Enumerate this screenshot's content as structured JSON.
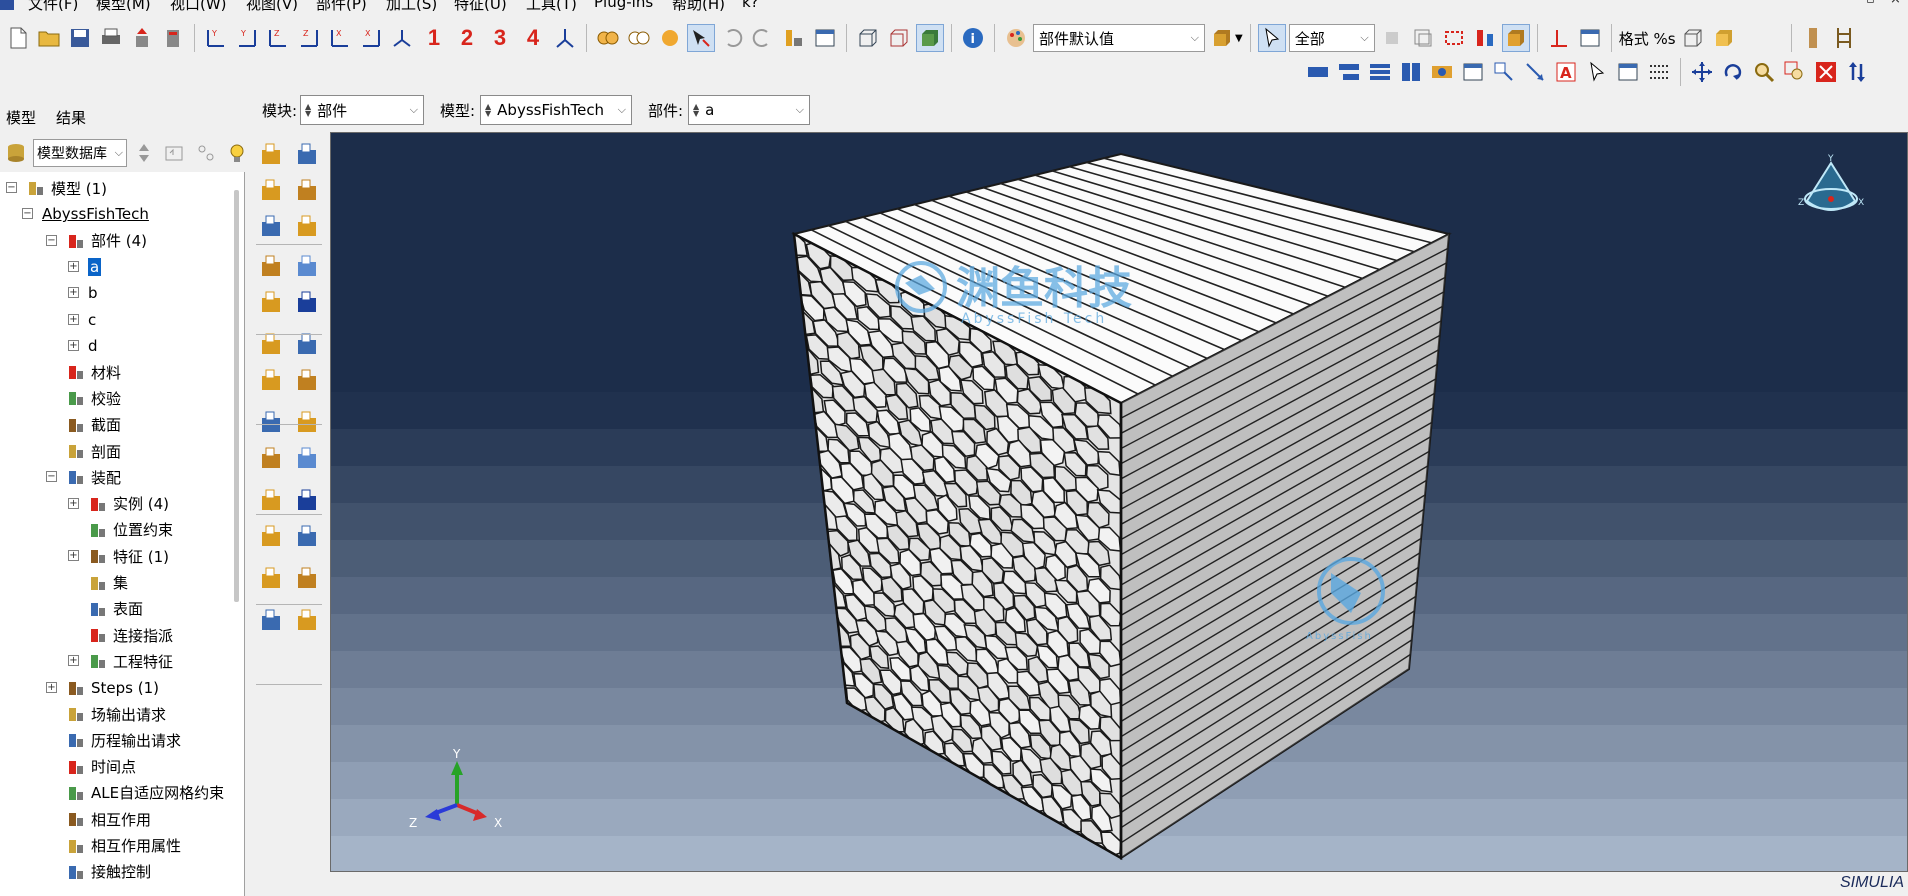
{
  "menu": [
    {
      "name": "menu-file",
      "label": "文件(F)"
    },
    {
      "name": "menu-model",
      "label": "模型(M)"
    },
    {
      "name": "menu-viewport",
      "label": "视口(W)"
    },
    {
      "name": "menu-view",
      "label": "视图(V)"
    },
    {
      "name": "menu-part",
      "label": "部件(P)"
    },
    {
      "name": "menu-shape",
      "label": "加工(S)"
    },
    {
      "name": "menu-feature",
      "label": "特征(U)"
    },
    {
      "name": "menu-tools",
      "label": "工具(T)"
    },
    {
      "name": "menu-plugins",
      "label": "Plug-ins"
    },
    {
      "name": "menu-help",
      "label": "帮助(H)"
    },
    {
      "name": "menu-context-help",
      "label": "k?"
    }
  ],
  "toolbar": {
    "viewport_numbers": [
      "1",
      "2",
      "3",
      "4"
    ],
    "render_style_value": "部件默认值",
    "selection_filter_value": "全部",
    "format_label": "格式 %s"
  },
  "tabs": {
    "model": "模型",
    "results": "结果"
  },
  "module_bar": {
    "module_label": "模块:",
    "module_value": "部件",
    "model_label": "模型:",
    "model_value": "AbyssFishTech",
    "part_label": "部件:",
    "part_value": "a"
  },
  "tree_header": {
    "database": "模型数据库"
  },
  "tree": [
    {
      "label": "模型 (1)",
      "level": 0,
      "expander": "⊟",
      "icon": "models-icon"
    },
    {
      "label": "AbyssFishTech",
      "level": 1,
      "expander": "⊟",
      "icon": "",
      "underline": true
    },
    {
      "label": "部件 (4)",
      "level": 2,
      "expander": "⊟",
      "icon": "parts-icon"
    },
    {
      "label": "a",
      "level": 3,
      "expander": "⊞",
      "icon": "",
      "selected": true
    },
    {
      "label": "b",
      "level": 3,
      "expander": "⊞",
      "icon": ""
    },
    {
      "label": "c",
      "level": 3,
      "expander": "⊞",
      "icon": ""
    },
    {
      "label": "d",
      "level": 3,
      "expander": "⊞",
      "icon": ""
    },
    {
      "label": "材料",
      "level": 2,
      "expander": "",
      "icon": "materials-icon"
    },
    {
      "label": "校验",
      "level": 2,
      "expander": "",
      "icon": "calibration-icon"
    },
    {
      "label": "截面",
      "level": 2,
      "expander": "",
      "icon": "sections-icon"
    },
    {
      "label": "剖面",
      "level": 2,
      "expander": "",
      "icon": "profiles-icon"
    },
    {
      "label": "装配",
      "level": 2,
      "expander": "⊟",
      "icon": "assembly-icon"
    },
    {
      "label": "实例 (4)",
      "level": 3,
      "expander": "⊞",
      "icon": "instances-icon"
    },
    {
      "label": "位置约束",
      "level": 3,
      "expander": "",
      "icon": "position-constraints-icon"
    },
    {
      "label": "特征 (1)",
      "level": 3,
      "expander": "⊞",
      "icon": "features-icon"
    },
    {
      "label": "集",
      "level": 3,
      "expander": "",
      "icon": "sets-icon"
    },
    {
      "label": "表面",
      "level": 3,
      "expander": "",
      "icon": "surfaces-icon"
    },
    {
      "label": "连接指派",
      "level": 3,
      "expander": "",
      "icon": "connector-assignments-icon"
    },
    {
      "label": "工程特征",
      "level": 3,
      "expander": "⊞",
      "icon": "engineering-features-icon"
    },
    {
      "label": "Steps (1)",
      "level": 2,
      "expander": "⊞",
      "icon": "steps-icon"
    },
    {
      "label": "场输出请求",
      "level": 2,
      "expander": "",
      "icon": "field-output-icon"
    },
    {
      "label": "历程输出请求",
      "level": 2,
      "expander": "",
      "icon": "history-output-icon"
    },
    {
      "label": "时间点",
      "level": 2,
      "expander": "",
      "icon": "time-points-icon"
    },
    {
      "label": "ALE自适应网格约束",
      "level": 2,
      "expander": "",
      "icon": "ale-constraints-icon"
    },
    {
      "label": "相互作用",
      "level": 2,
      "expander": "",
      "icon": "interactions-icon"
    },
    {
      "label": "相互作用属性",
      "level": 2,
      "expander": "",
      "icon": "interaction-properties-icon"
    },
    {
      "label": "接触控制",
      "level": 2,
      "expander": "",
      "icon": "contact-controls-icon"
    }
  ],
  "viewport": {
    "watermark_cn": "渊鱼科技",
    "watermark_en": "AbyssFish Tech",
    "watermark_small": "AbyssFish",
    "triad_x": "X",
    "triad_y": "Y",
    "triad_z": "Z",
    "compass_y": "Y",
    "compass_z": "Z",
    "compass_x": "X"
  },
  "branding": {
    "logo_text": "SIMULIA"
  },
  "colors": {
    "viewport_top": "#1c2d4a",
    "viewport_bottom": "#a5b4c8",
    "accent": "#0a64c8",
    "number_red": "#d8251c",
    "watermark_blue": "#5aa8e0"
  }
}
